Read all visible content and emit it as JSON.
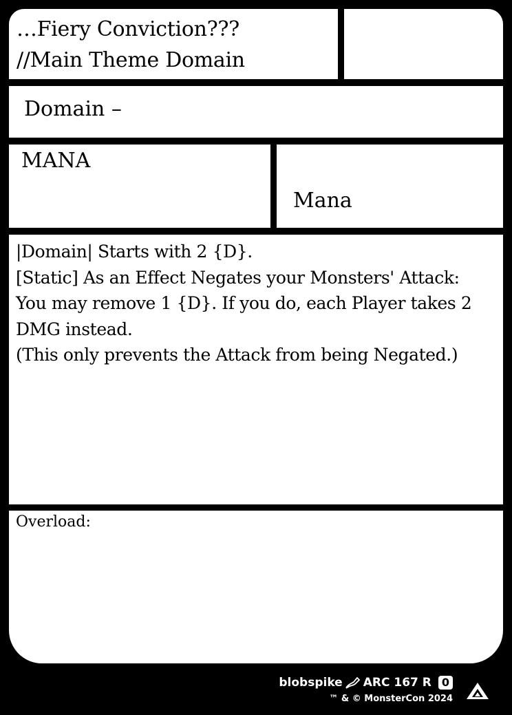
{
  "card": {
    "title_line1": "…Fiery Conviction???",
    "title_line2": "//Main Theme Domain",
    "type_line": "Domain –",
    "stat_left_label": "MANA",
    "stat_right_label": "Mana",
    "rules": [
      "|Domain| Starts with 2 {D}.",
      "[Static] As an Effect Negates your Monsters' Attack:",
      "You may remove 1 {D}. If you do, each Player takes 2",
      "DMG instead.",
      "(This only prevents the Attack from being Negated.)"
    ],
    "overload_label": "Overload:"
  },
  "footer": {
    "artist": "blobspike",
    "set_info": "ARC 167 R",
    "rarity_number": "0",
    "copyright": "™ & © MonsterCon 2024",
    "icons": [
      "pen-icon",
      "set-symbol-icon"
    ]
  },
  "colors": {
    "background": "#000000",
    "panel": "#ffffff"
  }
}
